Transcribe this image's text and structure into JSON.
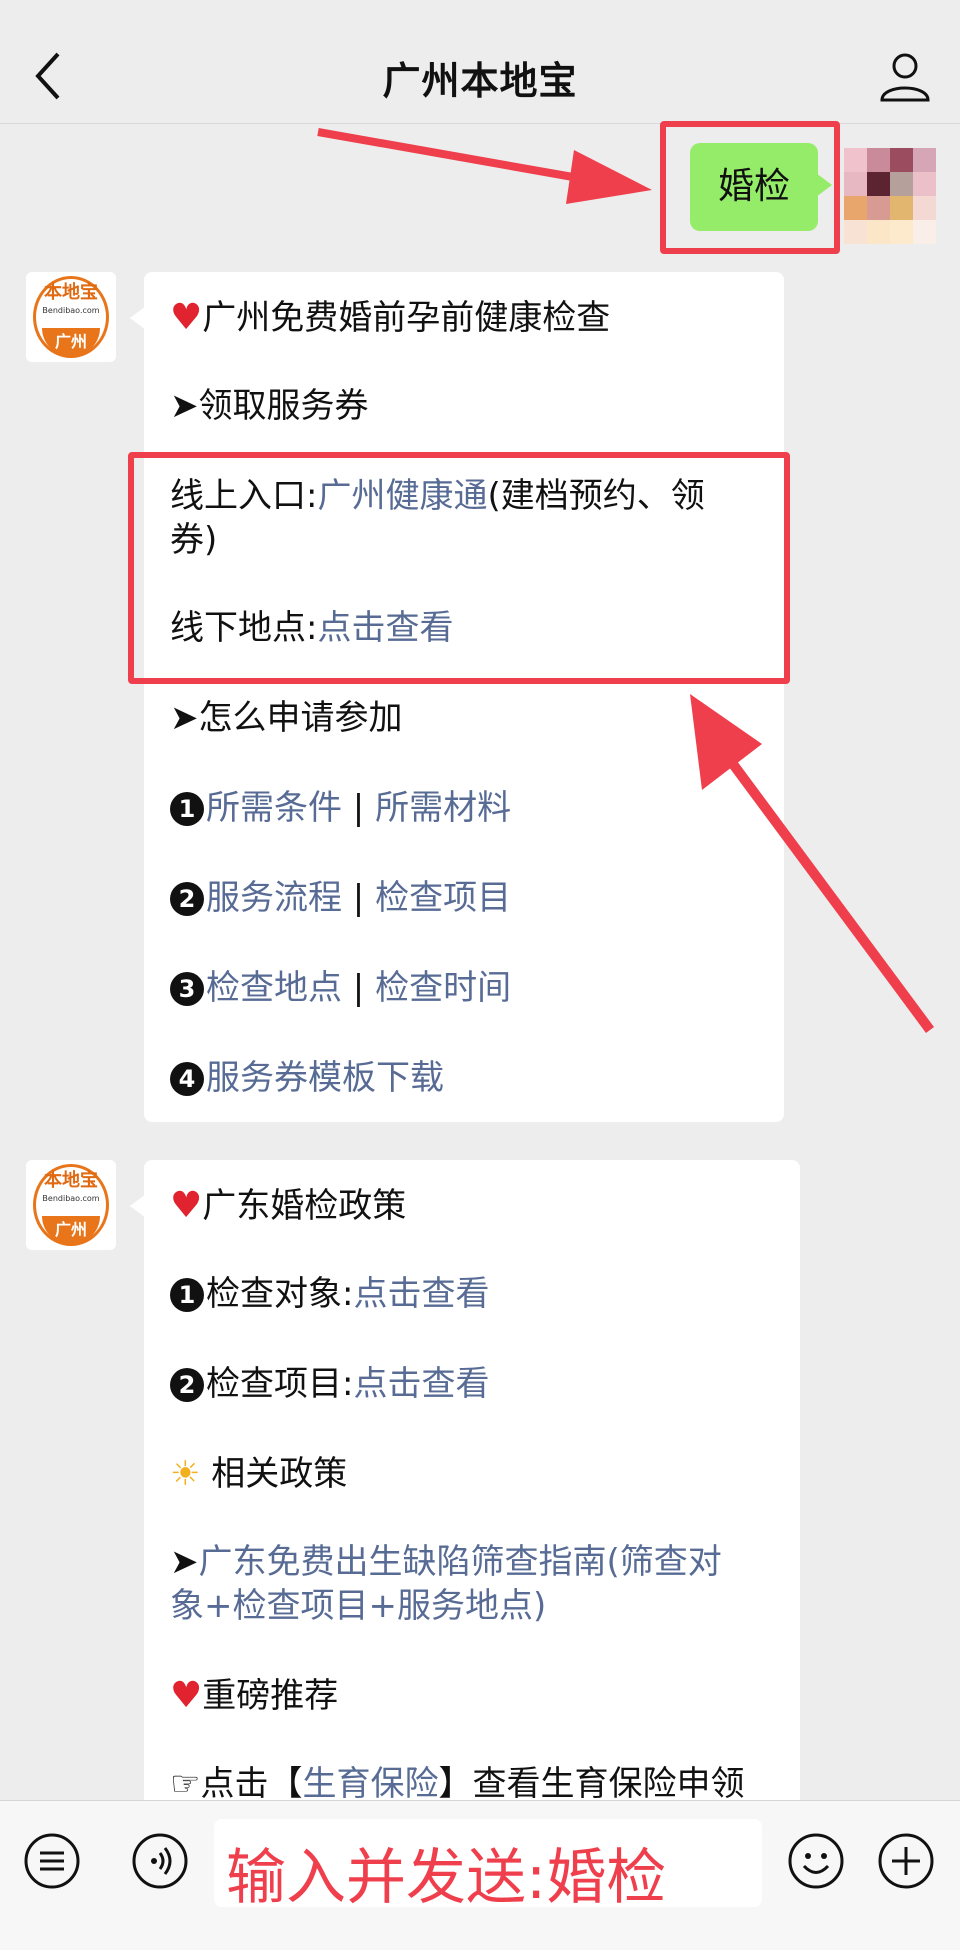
{
  "header": {
    "title": "广州本地宝"
  },
  "user_message": {
    "text": "婚检"
  },
  "bot_logo": {
    "top": "本地宝",
    "url": "Bendibao.com",
    "city": "广州"
  },
  "card1": {
    "title": "广州免费婚前孕前健康检查",
    "section1": "➤领取服务券",
    "online_label": "线上入口:",
    "online_link": "广州健康通",
    "online_paren_1": "(建档预约、领",
    "online_paren_2": "券)",
    "offline_label": "线下地点:",
    "offline_link": "点击查看",
    "section2": "➤怎么申请参加",
    "items": [
      {
        "num": "1",
        "a": "所需条件",
        "b": "所需材料"
      },
      {
        "num": "2",
        "a": "服务流程",
        "b": "检查项目"
      },
      {
        "num": "3",
        "a": "检查地点",
        "b": "检查时间"
      }
    ],
    "item4": {
      "num": "4",
      "a": "服务券模板下载"
    }
  },
  "card2": {
    "title": "广东婚检政策",
    "item1_label": "检查对象:",
    "item1_link": "点击查看",
    "item2_label": "检查项目:",
    "item2_link": "点击查看",
    "policy_title": "相关政策",
    "policy_link_1": "广东免费出生缺陷筛查指南(筛查对",
    "policy_link_2": "象+检查项目+服务地点)",
    "recommend_title": "重磅推荐",
    "rec_pre": "点击【",
    "rec_link": "生育保险",
    "rec_post": "】查看生育保险申领"
  },
  "bottom_bar": {
    "input_text": "输入并发送:婚检"
  },
  "colors": {
    "accent_red": "#ef3f4c",
    "link": "#576b95",
    "bubble_green": "#95ec69"
  }
}
